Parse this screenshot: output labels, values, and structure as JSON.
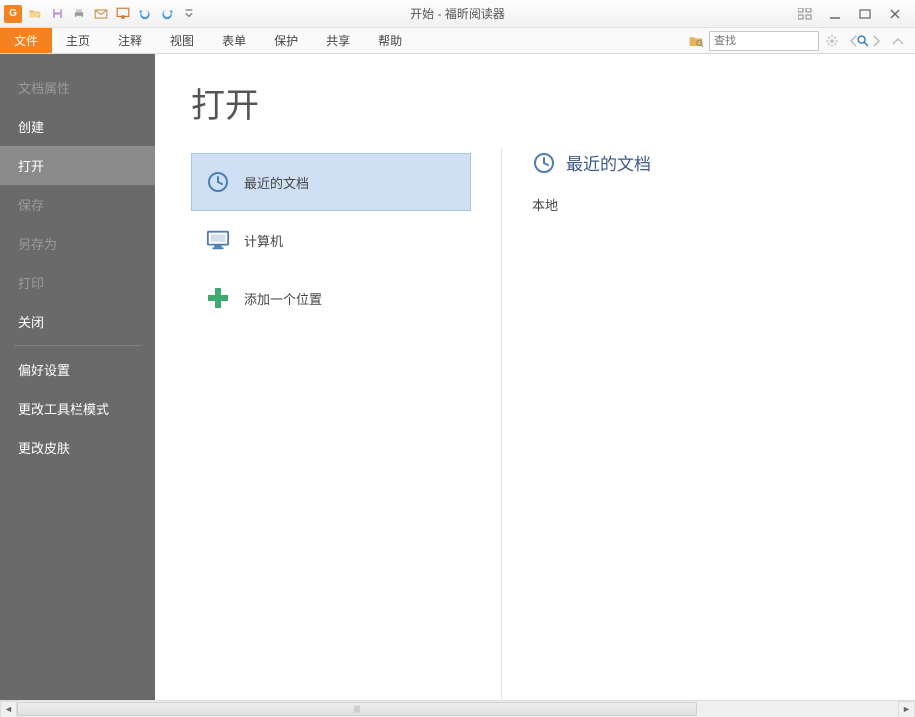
{
  "window": {
    "title": "开始 - 福昕阅读器"
  },
  "quickAccess": {
    "icons": [
      "app-logo",
      "open-icon",
      "save-icon",
      "print-icon",
      "mail-icon",
      "screenshot-icon",
      "undo-icon",
      "redo-icon",
      "qat-customize-icon"
    ]
  },
  "ribbon": {
    "tabs": [
      {
        "label": "文件",
        "active": true
      },
      {
        "label": "主页",
        "active": false
      },
      {
        "label": "注释",
        "active": false
      },
      {
        "label": "视图",
        "active": false
      },
      {
        "label": "表单",
        "active": false
      },
      {
        "label": "保护",
        "active": false
      },
      {
        "label": "共享",
        "active": false
      },
      {
        "label": "帮助",
        "active": false
      }
    ],
    "search": {
      "placeholder": "查找"
    }
  },
  "sidebar": {
    "items": [
      {
        "label": "文档属性",
        "state": "dim"
      },
      {
        "label": "创建",
        "state": "bright"
      },
      {
        "label": "打开",
        "state": "selected"
      },
      {
        "label": "保存",
        "state": "dim"
      },
      {
        "label": "另存为",
        "state": "dim"
      },
      {
        "label": "打印",
        "state": "dim"
      },
      {
        "label": "关闭",
        "state": "bright"
      }
    ],
    "lowerItems": [
      {
        "label": "偏好设置"
      },
      {
        "label": "更改工具栏模式"
      },
      {
        "label": "更改皮肤"
      }
    ]
  },
  "page": {
    "heading": "打开",
    "locations": [
      {
        "label": "最近的文档",
        "selected": true,
        "icon": "clock-icon"
      },
      {
        "label": "计算机",
        "selected": false,
        "icon": "computer-icon"
      },
      {
        "label": "添加一个位置",
        "selected": false,
        "icon": "add-place-icon"
      }
    ],
    "recent": {
      "title": "最近的文档",
      "localLabel": "本地"
    }
  }
}
